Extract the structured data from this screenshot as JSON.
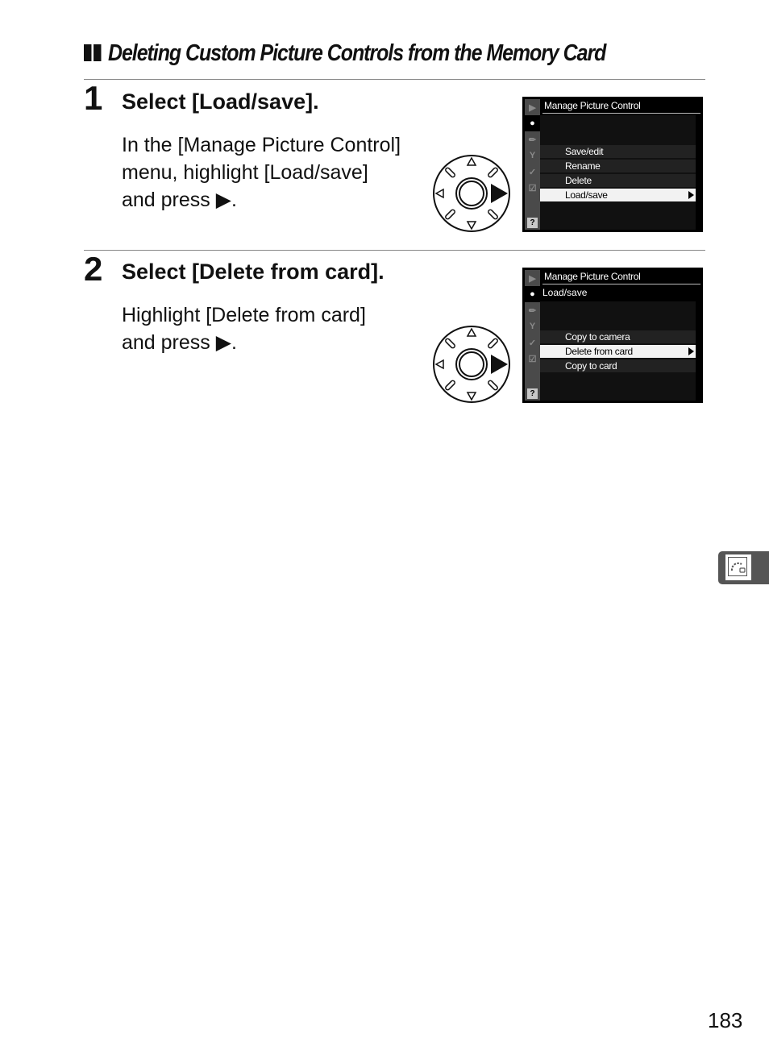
{
  "section": {
    "title": "Deleting Custom Picture Controls from the Memory Card"
  },
  "steps": [
    {
      "number": "1",
      "title": "Select [Load/save].",
      "body": [
        "In the [Manage Picture Control]",
        "menu, highlight [Load/save]",
        "and press ▶."
      ],
      "screen": {
        "header": "Manage Picture Control",
        "subtitle": "",
        "items": [
          "Save/edit",
          "Rename",
          "Delete",
          "Load/save"
        ],
        "selected_index": 3
      }
    },
    {
      "number": "2",
      "title": "Select [Delete from card].",
      "body": [
        "Highlight [Delete from card]",
        "and press ▶."
      ],
      "screen": {
        "header": "Manage Picture Control",
        "subtitle": "Load/save",
        "items": [
          "Copy to camera",
          "Delete from card",
          "Copy to card"
        ],
        "selected_index": 1
      }
    }
  ],
  "lcd_tabs": [
    "playback-icon",
    "camera-icon",
    "pencil-icon",
    "wrench-icon",
    "retouch-icon",
    "my-menu-icon",
    "help-icon"
  ],
  "lcd_help_label": "?",
  "side_tab_icon": "picture-control-icon",
  "page_number": "183"
}
